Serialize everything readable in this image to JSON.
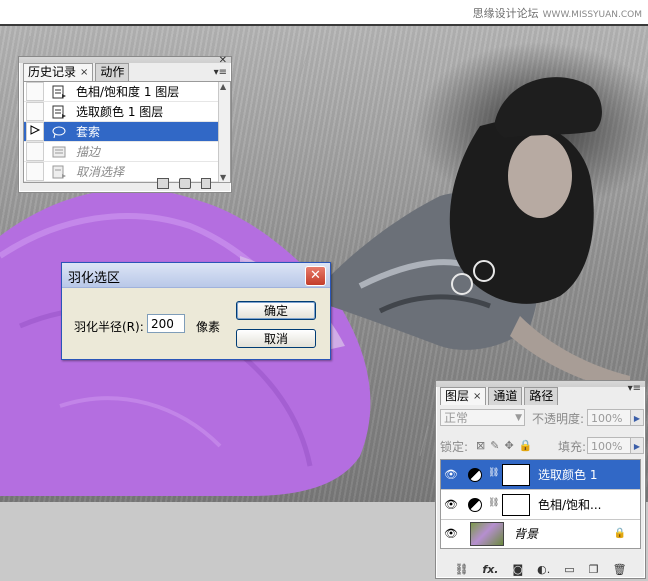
{
  "watermark": {
    "text": "思缘设计论坛",
    "sub": "WWW.MISSYUAN.COM"
  },
  "history_panel": {
    "tabs": [
      {
        "label": "历史记录",
        "active": true
      },
      {
        "label": "动作",
        "active": false
      }
    ],
    "items": [
      {
        "label": "色相/饱和度 1 图层",
        "state": "normal"
      },
      {
        "label": "选取颜色 1 图层",
        "state": "normal"
      },
      {
        "label": "套索",
        "state": "selected"
      },
      {
        "label": "描边",
        "state": "disabled"
      },
      {
        "label": "取消选择",
        "state": "disabled"
      }
    ],
    "icons": [
      "new-document-icon",
      "snapshot-camera-icon",
      "trash-icon"
    ]
  },
  "feather_dialog": {
    "title": "羽化选区",
    "radius_label": "羽化半径(R):",
    "radius_value": "200",
    "unit": "像素",
    "ok_label": "确定",
    "cancel_label": "取消"
  },
  "layers_panel": {
    "tabs": [
      {
        "label": "图层",
        "active": true
      },
      {
        "label": "通道",
        "active": false
      },
      {
        "label": "路径",
        "active": false
      }
    ],
    "blend_mode": "正常",
    "opacity_label": "不透明度:",
    "opacity_value": "100%",
    "lock_label": "锁定:",
    "fill_label": "填充:",
    "fill_value": "100%",
    "layers": [
      {
        "name": "选取颜色 1",
        "type": "adjustment",
        "selected": true
      },
      {
        "name": "色相/饱和...",
        "type": "adjustment",
        "selected": false
      },
      {
        "name": "背景",
        "type": "image",
        "selected": false,
        "locked": true
      }
    ],
    "footer_icons": [
      "link-icon",
      "fx-icon",
      "mask-icon",
      "adjustment-icon",
      "folder-icon",
      "new-layer-icon",
      "trash-icon"
    ]
  },
  "colors": {
    "selection": "#3168c6",
    "dress": "#b46ee0",
    "dialog_bg": "#ece9d8"
  }
}
